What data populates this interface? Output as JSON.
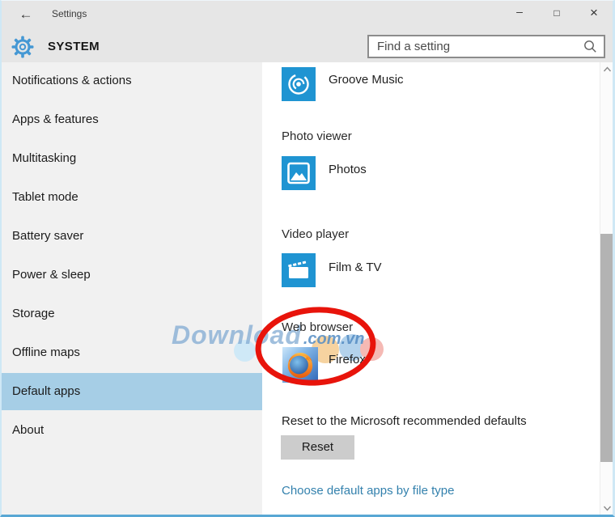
{
  "titlebar": {
    "back_icon": "←",
    "title": "Settings",
    "minimize_icon": "–",
    "maximize_icon": "□",
    "close_icon": "×"
  },
  "header": {
    "section_title": "SYSTEM",
    "search_placeholder": "Find a setting"
  },
  "sidebar": {
    "items": [
      {
        "label": "Notifications & actions",
        "active": false
      },
      {
        "label": "Apps & features",
        "active": false
      },
      {
        "label": "Multitasking",
        "active": false
      },
      {
        "label": "Tablet mode",
        "active": false
      },
      {
        "label": "Battery saver",
        "active": false
      },
      {
        "label": "Power & sleep",
        "active": false
      },
      {
        "label": "Storage",
        "active": false
      },
      {
        "label": "Offline maps",
        "active": false
      },
      {
        "label": "Default apps",
        "active": true
      },
      {
        "label": "About",
        "active": false
      }
    ]
  },
  "content": {
    "sections": [
      {
        "heading": "",
        "app_name": "Groove Music",
        "tile_icon": "groove-music-tile"
      },
      {
        "heading": "Photo viewer",
        "app_name": "Photos",
        "tile_icon": "photos-tile"
      },
      {
        "heading": "Video player",
        "app_name": "Film & TV",
        "tile_icon": "film-tv-tile"
      },
      {
        "heading": "Web browser",
        "app_name": "Firefox",
        "tile_icon": "firefox-tile"
      }
    ],
    "reset_heading": "Reset to the Microsoft recommended defaults",
    "reset_button_label": "Reset",
    "file_type_link": "Choose default apps by file type"
  },
  "watermark": {
    "main": "Download",
    "suffix": ".com.vn"
  },
  "annotation": {
    "shape": "red-ellipse",
    "color": "#e8140b"
  },
  "colors": {
    "tile_blue": "#1f94d2",
    "sidebar_highlight": "#a6cee6",
    "header_bg": "#e6e6e6",
    "link_blue": "#3381ad",
    "border_blue": "#cfe8f5",
    "annotation_red": "#e8140b"
  }
}
